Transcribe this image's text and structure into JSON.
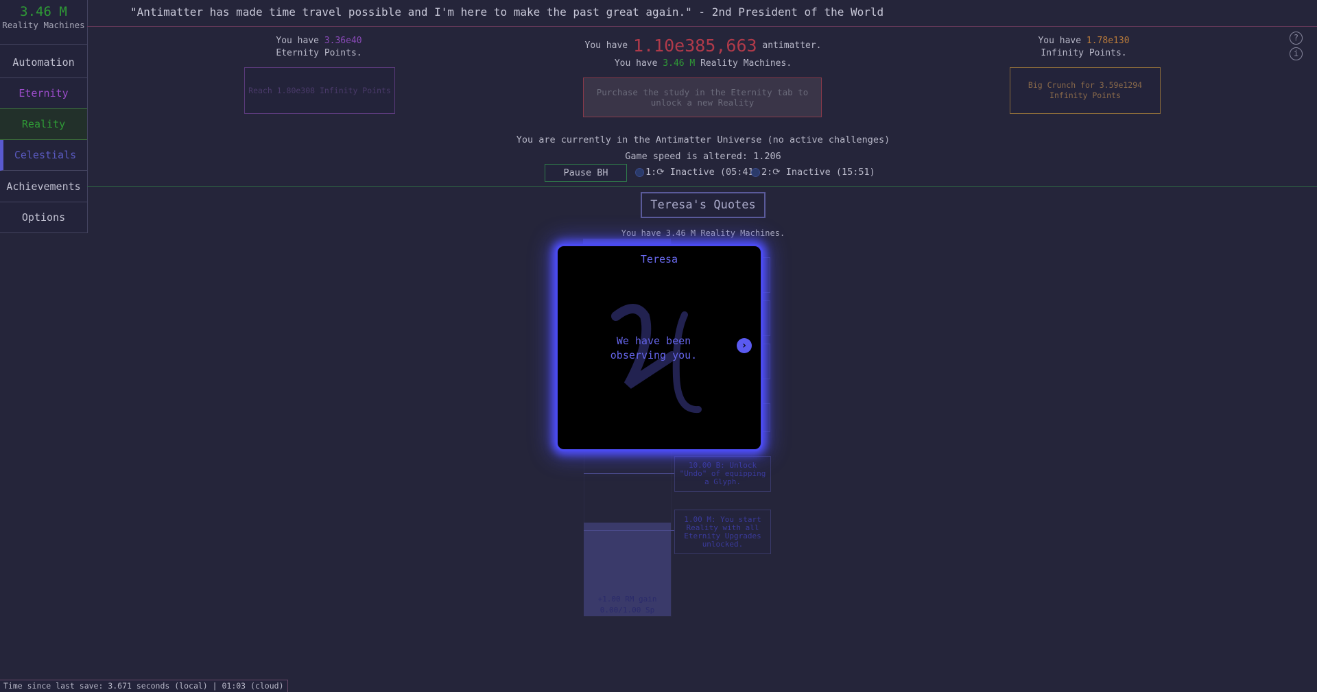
{
  "sidebar": {
    "rm_amount": "3.46 M",
    "rm_label": "Reality Machines",
    "tabs": [
      "Automation",
      "Eternity",
      "Reality",
      "Celestials",
      "Achievements",
      "Options"
    ]
  },
  "header": {
    "quote": "\"Antimatter has made time travel possible and I'm here to make the past great again.\" - 2nd President of the World",
    "ep_prefix": "You have",
    "ep_value": "3.36e40",
    "ep_suffix": "Eternity Points.",
    "am_prefix": "You have",
    "am_value": "1.10e385,663",
    "am_suffix": "antimatter.",
    "rm_prefix": "You have",
    "rm_value": "3.46 M",
    "rm_suffix": "Reality Machines.",
    "ip_prefix": "You have",
    "ip_value": "1.78e130",
    "ip_suffix": "Infinity Points.",
    "eternity_button": "Reach 1.80e308 Infinity Points",
    "reality_button": "Purchase the study in the Eternity tab to unlock a new Reality",
    "crunch_button": "Big Crunch for 3.59e1294 Infinity Points",
    "universe_status": "You are currently in the Antimatter Universe (no active challenges)",
    "game_speed": "Game speed is altered: 1.206",
    "pause_bh": "Pause BH",
    "bh1": "1:⟳ Inactive (05:41)",
    "bh2": "2:⟳ Inactive (15:51)"
  },
  "celestial": {
    "quotes_button": "Teresa's Quotes",
    "rm_line": "You have 3.46 M Reality Machines.",
    "card_undo": "10.00 B: Unlock \"Undo\" of equipping a Glyph.",
    "card_eternity": "1.00 M: You start Reality with all Eternity Upgrades unlocked.",
    "pour_text1": "+1.00 RM gain",
    "pour_text2": "0.00/1.00 Sp"
  },
  "modal": {
    "title": "Teresa",
    "message": "We have been observing you.",
    "symbol_icon": "teresa-glyph",
    "accent": "#4a4af0"
  },
  "footer": {
    "save_text": "Time since last save: 3.671 seconds (local) | 01:03 (cloud)"
  },
  "icons": {
    "help": "?",
    "info": "i",
    "next": "›"
  }
}
